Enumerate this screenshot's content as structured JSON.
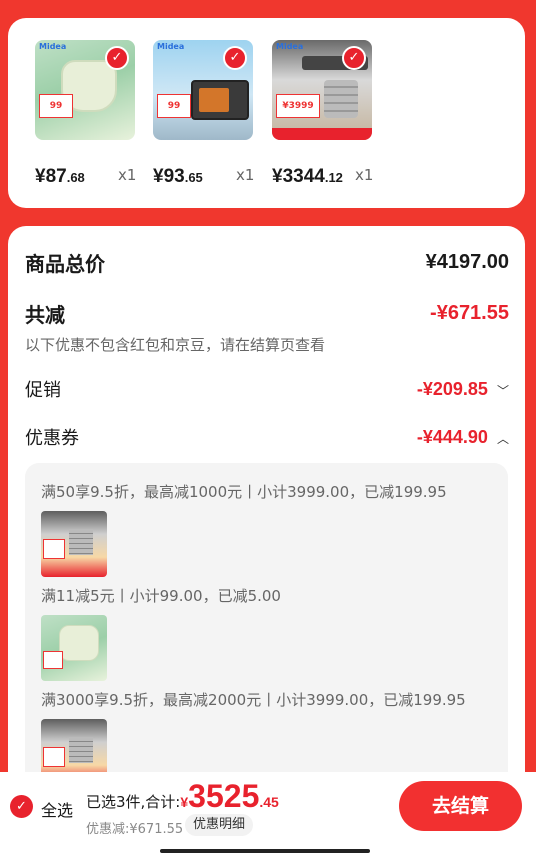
{
  "products": [
    {
      "brand": "Midea",
      "promo": "99",
      "price_int": "¥87",
      "price_dec": ".68",
      "qty": "x1"
    },
    {
      "brand": "Midea",
      "promo": "99",
      "price_int": "¥93",
      "price_dec": ".65",
      "qty": "x1"
    },
    {
      "brand": "Midea",
      "promo": "¥3999",
      "price_int": "¥3344",
      "price_dec": ".12",
      "qty": "x1"
    }
  ],
  "summary": {
    "total_label": "商品总价",
    "total_value": "¥4197.00",
    "reduce_label": "共减",
    "reduce_value": "-¥671.55",
    "note": "以下优惠不包含红包和京豆，请在结算页查看",
    "promo_label": "促销",
    "promo_value": "-¥209.85",
    "coupon_label": "优惠券",
    "coupon_value": "-¥444.90"
  },
  "coupons": [
    "满50享9.5折，最高减1000元丨小计3999.00，已减199.95",
    "满11减5元丨小计99.00，已减5.00",
    "满3000享9.5折，最高减2000元丨小计3999.00，已减199.95"
  ],
  "bottom": {
    "select_all": "全选",
    "selected_text": "已选3件,合计:",
    "currency": "¥",
    "total_int": "3525",
    "total_dec": ".45",
    "discount": "优惠减:¥671.55",
    "detail_button": "优惠明细",
    "checkout": "去结算"
  },
  "colors": {
    "accent": "#e8222d",
    "background": "#f0372e"
  },
  "icons": {
    "check": "check-icon",
    "chevron_down": "chevron-down-icon",
    "chevron_up": "chevron-up-icon"
  }
}
